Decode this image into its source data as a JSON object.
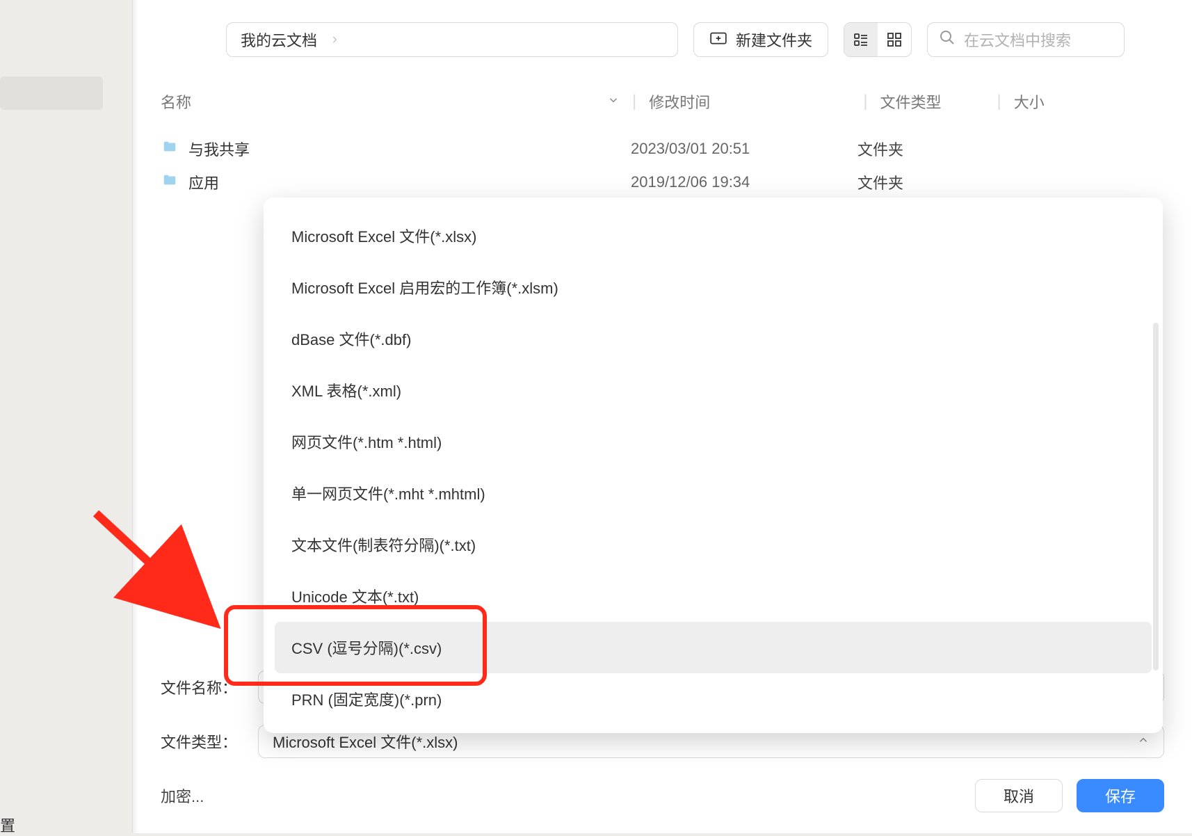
{
  "sidebar": {
    "bottom_label": "置"
  },
  "toolbar": {
    "breadcrumb": "我的云文档",
    "new_folder": "新建文件夹",
    "search_placeholder": "在云文档中搜索"
  },
  "columns": {
    "name": "名称",
    "modified": "修改时间",
    "type": "文件类型",
    "size": "大小"
  },
  "files": [
    {
      "name": "与我共享",
      "modified": "2023/03/01 20:51",
      "type": "文件夹"
    },
    {
      "name": "应用",
      "modified": "2019/12/06 19:34",
      "type": "文件夹"
    }
  ],
  "form": {
    "filename_label": "文件名称：",
    "filetype_label": "文件类型：",
    "filetype_value": "Microsoft Excel 文件(*.xlsx)",
    "encrypt": "加密...",
    "cancel": "取消",
    "save": "保存"
  },
  "dropdown": {
    "items": [
      "Microsoft Excel 文件(*.xlsx)",
      "Microsoft Excel 启用宏的工作簿(*.xlsm)",
      "dBase 文件(*.dbf)",
      "XML 表格(*.xml)",
      "网页文件(*.htm *.html)",
      "单一网页文件(*.mht *.mhtml)",
      "文本文件(制表符分隔)(*.txt)",
      "Unicode 文本(*.txt)",
      "CSV (逗号分隔)(*.csv)",
      "PRN (固定宽度)(*.prn)"
    ],
    "hover_index": 8
  }
}
